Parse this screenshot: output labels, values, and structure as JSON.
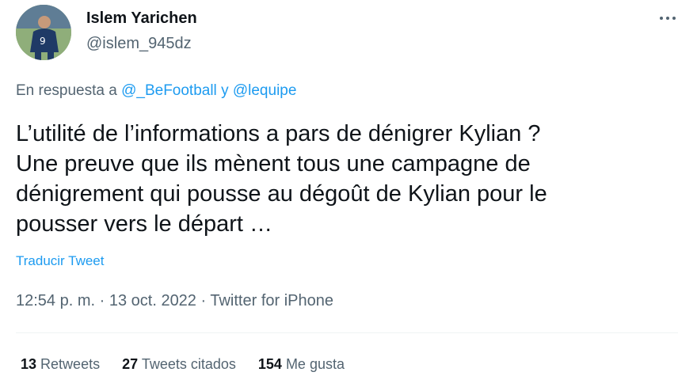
{
  "user": {
    "name": "Islem Yarichen",
    "handle": "@islem_945dz"
  },
  "reply": {
    "prefix": "En respuesta a ",
    "mention1": "@_BeFootball",
    "joiner": " y ",
    "mention2": "@lequipe"
  },
  "tweet": {
    "lines": [
      "L’utilité de l’informations a pars de dénigrer Kylian ?",
      "Une preuve que ils mènent tous une campagne de",
      "dénigrement qui pousse au dégoût de Kylian pour le",
      "pousser vers le départ …"
    ],
    "translate_label": "Traducir Tweet"
  },
  "meta": {
    "time": "12:54 p. m.",
    "sep1": " · ",
    "date": "13 oct. 2022",
    "sep2": " · ",
    "source": "Twitter for iPhone"
  },
  "stats": {
    "retweets_count": "13",
    "retweets_label": "Retweets",
    "quotes_count": "27",
    "quotes_label": "Tweets citados",
    "likes_count": "154",
    "likes_label": "Me gusta"
  },
  "icons": {
    "more": "more-horizontal-icon"
  },
  "colors": {
    "accent": "#1d9bf0",
    "text": "#0f1419",
    "secondary": "#536471"
  }
}
